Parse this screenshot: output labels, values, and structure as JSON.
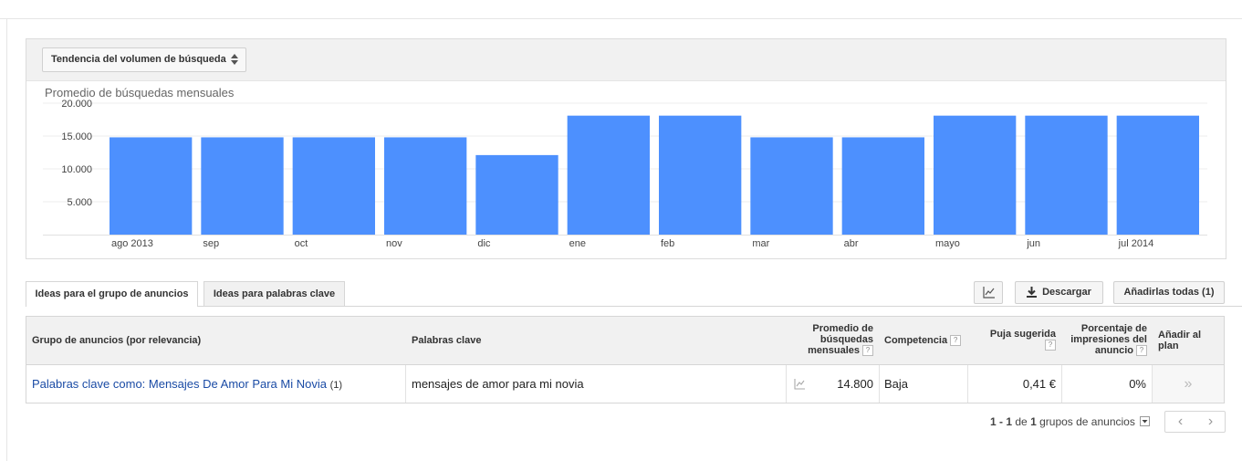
{
  "metric_selector": {
    "label": "Tendencia del volumen de búsqueda"
  },
  "chart_data": {
    "type": "bar",
    "title": "Promedio de búsquedas mensuales",
    "categories": [
      "ago 2013",
      "sep",
      "oct",
      "nov",
      "dic",
      "ene",
      "feb",
      "mar",
      "abr",
      "mayo",
      "jun",
      "jul 2014"
    ],
    "values": [
      14800,
      14800,
      14800,
      14800,
      12100,
      18100,
      18100,
      14800,
      14800,
      18100,
      18100,
      18100
    ],
    "yticks": [
      "5.000",
      "10.000",
      "15.000",
      "20.000"
    ],
    "ytick_values": [
      5000,
      10000,
      15000,
      20000
    ],
    "ylim": [
      0,
      20000
    ],
    "bar_color": "#4d90fe",
    "grid": true
  },
  "tabs": [
    {
      "label": "Ideas para el grupo de anuncios",
      "active": true
    },
    {
      "label": "Ideas para palabras clave",
      "active": false
    }
  ],
  "toolbar": {
    "graph_icon": "line-chart-icon",
    "download_label": "Descargar",
    "add_all_label": "Añadirlas todas (1)"
  },
  "table": {
    "headers": {
      "adgroup": "Grupo de anuncios (por relevancia)",
      "keywords": "Palabras clave",
      "avg_searches_1": "Promedio de",
      "avg_searches_2": "búsquedas",
      "avg_searches_3": "mensuales",
      "competition": "Competencia",
      "bid": "Puja sugerida",
      "impr_1": "Porcentaje de",
      "impr_2": "impresiones del",
      "impr_3": "anuncio",
      "add_1": "Añadir al",
      "add_2": "plan",
      "help": "?"
    },
    "rows": [
      {
        "adgroup": "Palabras clave como: Mensajes De Amor Para Mi Novia",
        "adgroup_count": "(1)",
        "keywords": "mensajes de amor para mi novia",
        "avg_searches": "14.800",
        "competition": "Baja",
        "bid": "0,41 €",
        "impr_share": "0%",
        "add": "»"
      }
    ]
  },
  "pagination": {
    "range": "1 - 1",
    "of": "de",
    "total": "1",
    "unit": "grupos de anuncios",
    "prev": "‹",
    "next": "›"
  }
}
